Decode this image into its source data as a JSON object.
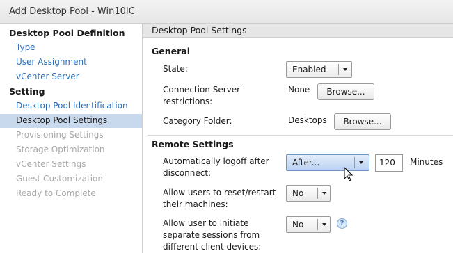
{
  "window": {
    "title": "Add Desktop Pool - Win10IC"
  },
  "sidebar": {
    "sections": [
      {
        "heading": "Desktop Pool Definition",
        "items": [
          {
            "label": "Type",
            "state": "link"
          },
          {
            "label": "User Assignment",
            "state": "link"
          },
          {
            "label": "vCenter Server",
            "state": "link"
          }
        ]
      },
      {
        "heading": "Setting",
        "items": [
          {
            "label": "Desktop Pool Identification",
            "state": "link"
          },
          {
            "label": "Desktop Pool Settings",
            "state": "selected"
          },
          {
            "label": "Provisioning Settings",
            "state": "disabled"
          },
          {
            "label": "Storage Optimization",
            "state": "disabled"
          },
          {
            "label": "vCenter Settings",
            "state": "disabled"
          },
          {
            "label": "Guest Customization",
            "state": "disabled"
          },
          {
            "label": "Ready to Complete",
            "state": "disabled"
          }
        ]
      }
    ]
  },
  "content": {
    "header": "Desktop Pool Settings",
    "general": {
      "title": "General",
      "state_label": "State:",
      "state_value": "Enabled",
      "conn_label_line1": "Connection Server",
      "conn_label_line2": "restrictions:",
      "conn_value": "None",
      "conn_browse": "Browse...",
      "category_label": "Category Folder:",
      "category_value": "Desktops",
      "category_browse": "Browse..."
    },
    "remote": {
      "title": "Remote Settings",
      "logoff_label_line1": "Automatically logoff after",
      "logoff_label_line2": "disconnect:",
      "logoff_value": "After...",
      "logoff_minutes": "120",
      "logoff_unit": "Minutes",
      "reset_label_line1": "Allow users to reset/restart",
      "reset_label_line2": "their machines:",
      "reset_value": "No",
      "multi_label_line1": "Allow user to initiate",
      "multi_label_line2": "separate sessions from",
      "multi_label_line3": "different client devices:",
      "multi_value": "No",
      "help_glyph": "?"
    }
  },
  "colors": {
    "link": "#2a6ebb",
    "selected_bg": "#c8d9ee",
    "disabled": "#a8a8a8"
  }
}
